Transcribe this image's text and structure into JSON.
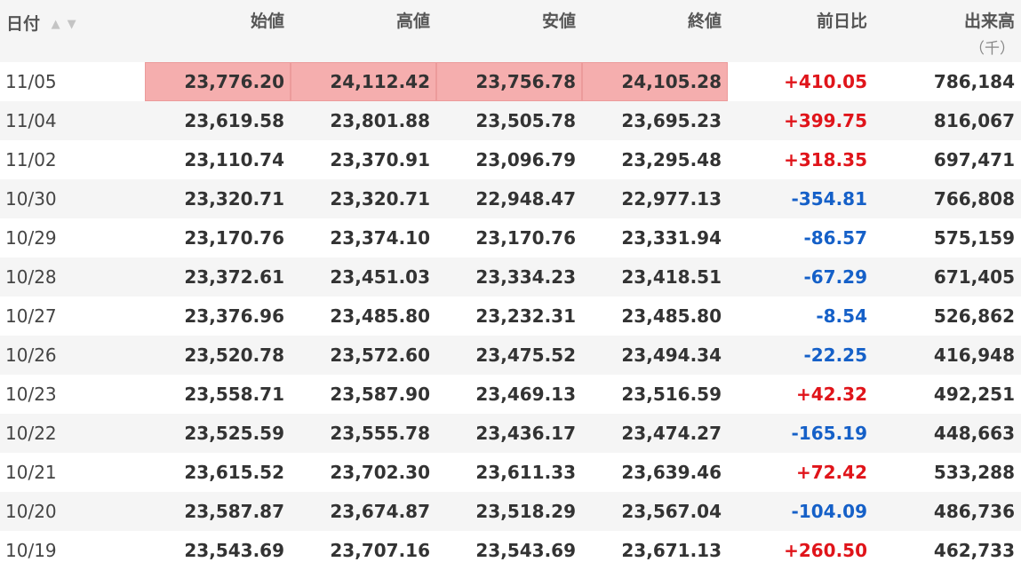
{
  "table": {
    "headers": {
      "date": "日付",
      "open": "始値",
      "high": "高値",
      "low": "安値",
      "close": "終値",
      "change": "前日比",
      "volume": "出来高",
      "volume_unit": "（千）"
    },
    "sort_icons": [
      "sort-ascending-icon",
      "sort-descending-icon"
    ],
    "colors": {
      "positive": "#e0141a",
      "negative": "#1560c8",
      "highlight": "#f5aeae"
    },
    "rows": [
      {
        "date": "11/05",
        "open": "23,776.20",
        "high": "24,112.42",
        "low": "23,756.78",
        "close": "24,105.28",
        "change": "+410.05",
        "volume": "786,184"
      },
      {
        "date": "11/04",
        "open": "23,619.58",
        "high": "23,801.88",
        "low": "23,505.78",
        "close": "23,695.23",
        "change": "+399.75",
        "volume": "816,067"
      },
      {
        "date": "11/02",
        "open": "23,110.74",
        "high": "23,370.91",
        "low": "23,096.79",
        "close": "23,295.48",
        "change": "+318.35",
        "volume": "697,471"
      },
      {
        "date": "10/30",
        "open": "23,320.71",
        "high": "23,320.71",
        "low": "22,948.47",
        "close": "22,977.13",
        "change": "-354.81",
        "volume": "766,808"
      },
      {
        "date": "10/29",
        "open": "23,170.76",
        "high": "23,374.10",
        "low": "23,170.76",
        "close": "23,331.94",
        "change": "-86.57",
        "volume": "575,159"
      },
      {
        "date": "10/28",
        "open": "23,372.61",
        "high": "23,451.03",
        "low": "23,334.23",
        "close": "23,418.51",
        "change": "-67.29",
        "volume": "671,405"
      },
      {
        "date": "10/27",
        "open": "23,376.96",
        "high": "23,485.80",
        "low": "23,232.31",
        "close": "23,485.80",
        "change": "-8.54",
        "volume": "526,862"
      },
      {
        "date": "10/26",
        "open": "23,520.78",
        "high": "23,572.60",
        "low": "23,475.52",
        "close": "23,494.34",
        "change": "-22.25",
        "volume": "416,948"
      },
      {
        "date": "10/23",
        "open": "23,558.71",
        "high": "23,587.90",
        "low": "23,469.13",
        "close": "23,516.59",
        "change": "+42.32",
        "volume": "492,251"
      },
      {
        "date": "10/22",
        "open": "23,525.59",
        "high": "23,555.78",
        "low": "23,436.17",
        "close": "23,474.27",
        "change": "-165.19",
        "volume": "448,663"
      },
      {
        "date": "10/21",
        "open": "23,615.52",
        "high": "23,702.30",
        "low": "23,611.33",
        "close": "23,639.46",
        "change": "+72.42",
        "volume": "533,288"
      },
      {
        "date": "10/20",
        "open": "23,587.87",
        "high": "23,674.87",
        "low": "23,518.29",
        "close": "23,567.04",
        "change": "-104.09",
        "volume": "486,736"
      },
      {
        "date": "10/19",
        "open": "23,543.69",
        "high": "23,707.16",
        "low": "23,543.69",
        "close": "23,671.13",
        "change": "+260.50",
        "volume": "462,733"
      }
    ]
  }
}
